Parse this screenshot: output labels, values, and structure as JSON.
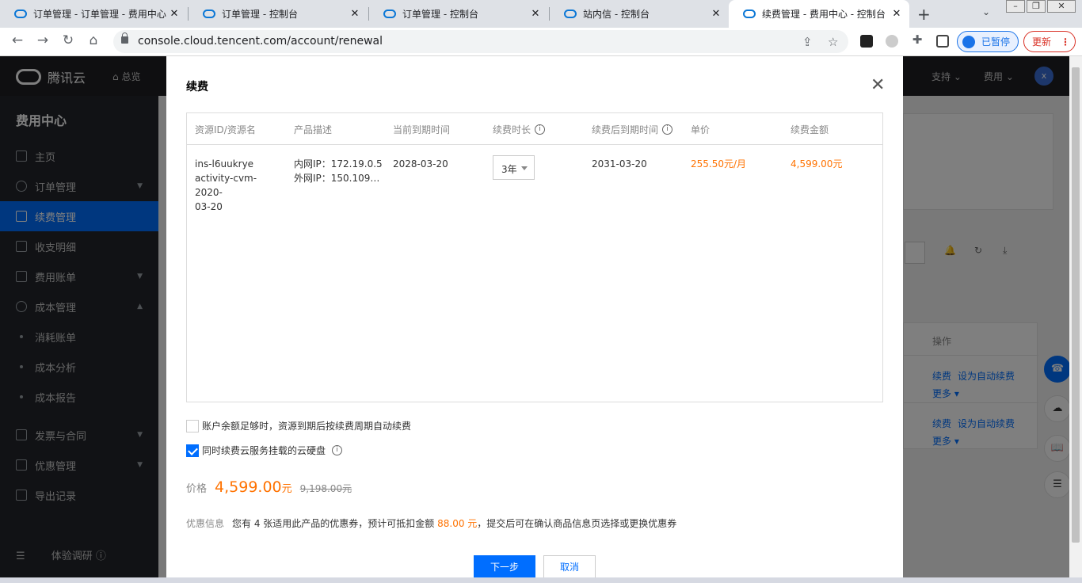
{
  "browser": {
    "tabs": [
      {
        "title": "订单管理 - 订单管理 - 费用中心",
        "active": false
      },
      {
        "title": "订单管理 - 控制台",
        "active": false
      },
      {
        "title": "订单管理 - 控制台",
        "active": false
      },
      {
        "title": "站内信 - 控制台",
        "active": false
      },
      {
        "title": "续费管理 - 费用中心 - 控制台",
        "active": true
      }
    ],
    "url": "console.cloud.tencent.com/account/renewal",
    "profile_label": "已暂停",
    "update_label": "更新"
  },
  "topnav": {
    "brand": "腾讯云",
    "overview": "总览",
    "items": [
      "支持",
      "费用"
    ],
    "avatar": "x"
  },
  "sidebar": {
    "title": "费用中心",
    "items": [
      {
        "label": "主页",
        "type": "icon",
        "arrow": false,
        "active": false
      },
      {
        "label": "订单管理",
        "type": "icon",
        "arrow": true,
        "active": false
      },
      {
        "label": "续费管理",
        "type": "icon",
        "arrow": false,
        "active": true
      },
      {
        "label": "收支明细",
        "type": "icon",
        "arrow": false,
        "active": false
      },
      {
        "label": "费用账单",
        "type": "icon",
        "arrow": true,
        "active": false
      },
      {
        "label": "成本管理",
        "type": "icon",
        "arrow": true,
        "active": false
      },
      {
        "label": "消耗账单",
        "type": "dot",
        "arrow": false,
        "active": false
      },
      {
        "label": "成本分析",
        "type": "dot",
        "arrow": false,
        "active": false
      },
      {
        "label": "成本报告",
        "type": "dot",
        "arrow": false,
        "active": false
      },
      {
        "label": "发票与合同",
        "type": "icon",
        "arrow": true,
        "active": false
      },
      {
        "label": "优惠管理",
        "type": "icon",
        "arrow": true,
        "active": false
      },
      {
        "label": "导出记录",
        "type": "icon",
        "arrow": false,
        "active": false
      }
    ],
    "footer": "体验调研"
  },
  "background": {
    "ops_header": "操作",
    "row_links": [
      "续费",
      "设为自动续费",
      "更多"
    ]
  },
  "modal": {
    "title": "续费",
    "table": {
      "headers": [
        "资源ID/资源名",
        "产品描述",
        "当前到期时间",
        "续费时长",
        "续费后到期时间",
        "单价",
        "续费金额"
      ],
      "row": {
        "resource_id": "ins-l6uukrye",
        "resource_name_1": "activity-cvm-2020-",
        "resource_name_2": "03-20",
        "private_ip": "内网IP：172.19.0.5",
        "public_ip": "外网IP：150.109…",
        "current_expiry": "2028-03-20",
        "duration": "3年",
        "new_expiry": "2031-03-20",
        "unit_price": "255.50元/月",
        "amount": "4,599.00元"
      }
    },
    "auto_renew_label": "账户余额足够时，资源到期后按续费周期自动续费",
    "auto_renew_checked": false,
    "disk_renew_label": "同时续费云服务挂载的云硬盘",
    "disk_renew_checked": true,
    "price_label": "价格",
    "price_value": "4,599.00",
    "price_unit": "元",
    "price_original": "9,198.00元",
    "discount_label": "优惠信息",
    "discount_text_1": "您有 4 张适用此产品的优惠券，预计可抵扣金额",
    "discount_amount": "88.00 元",
    "discount_text_2": "，提交后可在确认商品信息页选择或更换优惠券",
    "next_button": "下一步",
    "cancel_button": "取消"
  }
}
